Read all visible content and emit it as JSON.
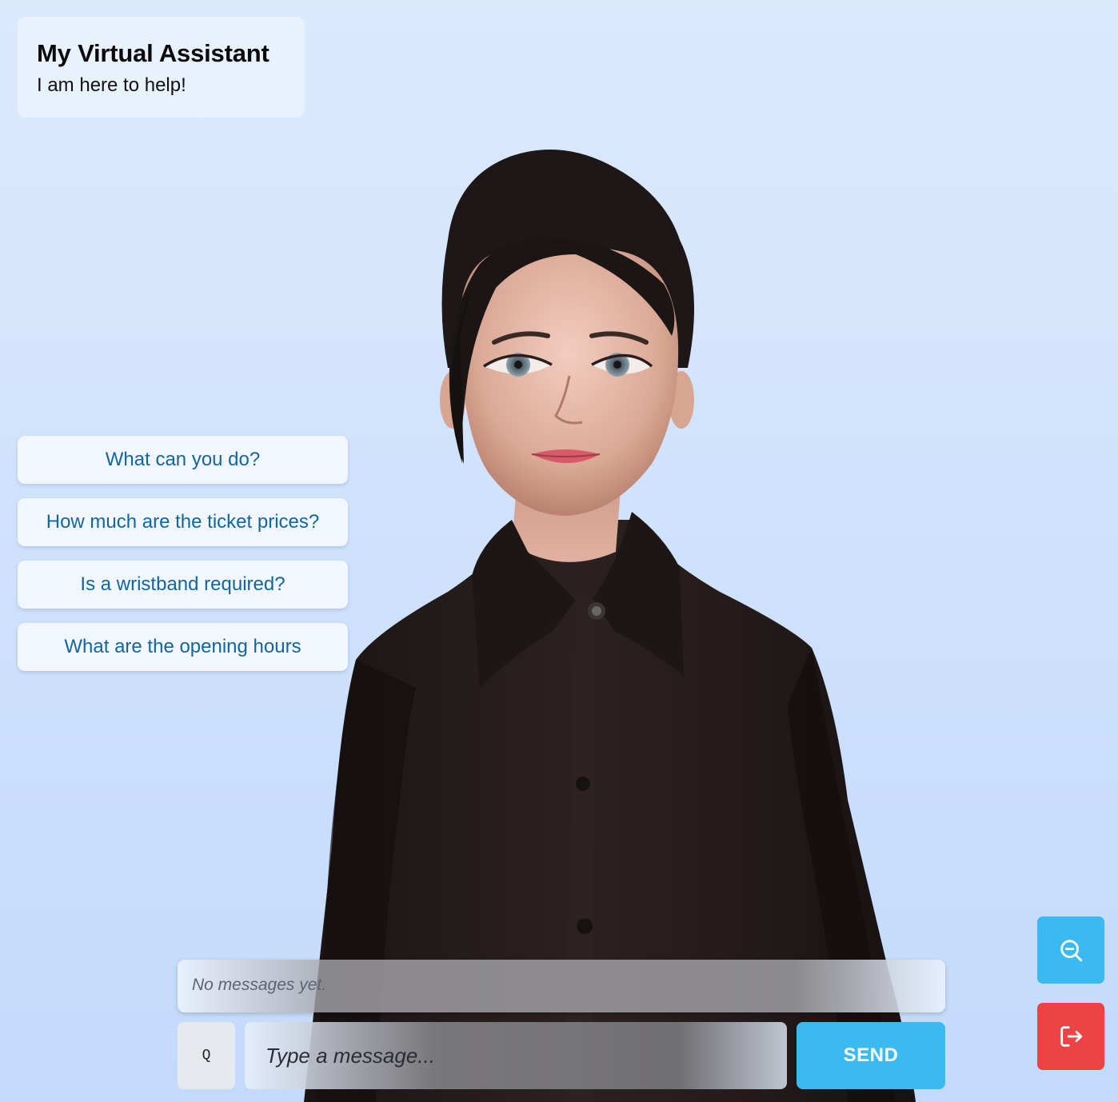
{
  "header": {
    "title": "My Virtual Assistant",
    "subtitle": "I am here to help!"
  },
  "avatar": {
    "label": "3D virtual assistant avatar",
    "colors": {
      "hair": "#1c1616",
      "skin": "#e6b6a6",
      "shirt": "#231a1a",
      "lips": "#d65a6a",
      "eyes": "#7b8f9a"
    }
  },
  "quick_questions": [
    {
      "label": "What can you do?"
    },
    {
      "label": "How much are the ticket prices?"
    },
    {
      "label": "Is a wristband required?"
    },
    {
      "label": "What are the opening hours"
    }
  ],
  "messages": {
    "empty_text": "No messages yet."
  },
  "composer": {
    "q_label": "Q",
    "placeholder": "Type a message...",
    "send_label": "SEND"
  },
  "side_buttons": {
    "zoom": {
      "icon": "zoom-out-icon",
      "color": "#3bbaf2"
    },
    "exit": {
      "icon": "logout-icon",
      "color": "#ec4444"
    }
  },
  "colors": {
    "background_top": "#dbe9fd",
    "background_bottom": "#c3dafb",
    "accent": "#3bbaf2",
    "danger": "#ec4444",
    "question_text": "#1266a0"
  }
}
